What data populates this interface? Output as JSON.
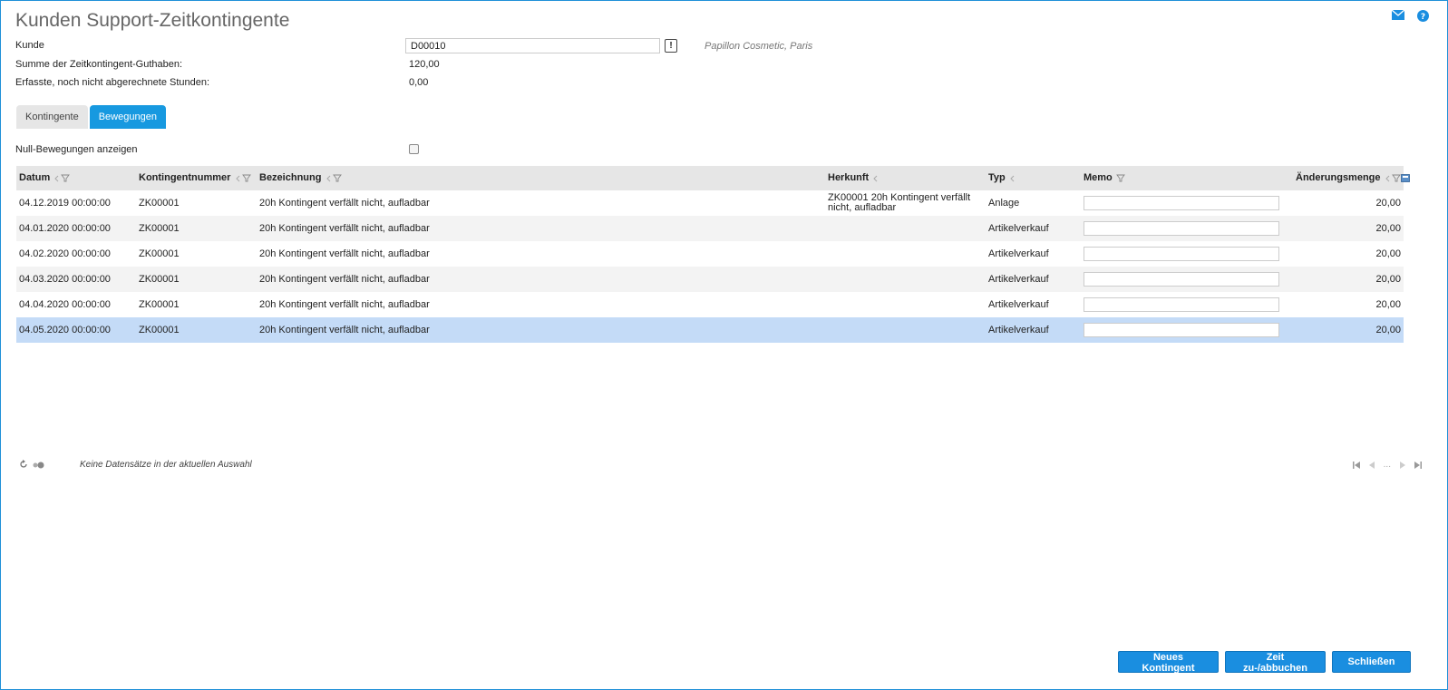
{
  "page": {
    "title": "Kunden Support-Zeitkontingente"
  },
  "customer": {
    "label": "Kunde",
    "value": "D00010",
    "lookup_button": "!",
    "name": "Papillon Cosmetic, Paris"
  },
  "summary": {
    "sum_label": "Summe der Zeitkontingent-Guthaben:",
    "sum_value": "120,00",
    "open_label": "Erfasste, noch nicht abgerechnete Stunden:",
    "open_value": "0,00"
  },
  "tabs": [
    {
      "label": "Kontingente",
      "active": false
    },
    {
      "label": "Bewegungen",
      "active": true
    }
  ],
  "filter": {
    "null_label": "Null-Bewegungen anzeigen",
    "null_checked": false
  },
  "grid": {
    "columns": {
      "datum": "Datum",
      "kontingentnummer": "Kontingentnummer",
      "bezeichnung": "Bezeichnung",
      "herkunft": "Herkunft",
      "typ": "Typ",
      "memo": "Memo",
      "aenderungsmenge": "Änderungsmenge"
    },
    "rows": [
      {
        "datum": "04.12.2019 00:00:00",
        "kontingentnummer": "ZK00001",
        "bezeichnung": "20h Kontingent verfällt nicht, aufladbar",
        "herkunft": "ZK00001 20h Kontingent verfällt nicht, aufladbar",
        "typ": "Anlage",
        "memo": "",
        "aenderungsmenge": "20,00"
      },
      {
        "datum": "04.01.2020 00:00:00",
        "kontingentnummer": "ZK00001",
        "bezeichnung": "20h Kontingent verfällt nicht, aufladbar",
        "herkunft": "",
        "typ": "Artikelverkauf",
        "memo": "",
        "aenderungsmenge": "20,00"
      },
      {
        "datum": "04.02.2020 00:00:00",
        "kontingentnummer": "ZK00001",
        "bezeichnung": "20h Kontingent verfällt nicht, aufladbar",
        "herkunft": "",
        "typ": "Artikelverkauf",
        "memo": "",
        "aenderungsmenge": "20,00"
      },
      {
        "datum": "04.03.2020 00:00:00",
        "kontingentnummer": "ZK00001",
        "bezeichnung": "20h Kontingent verfällt nicht, aufladbar",
        "herkunft": "",
        "typ": "Artikelverkauf",
        "memo": "",
        "aenderungsmenge": "20,00"
      },
      {
        "datum": "04.04.2020 00:00:00",
        "kontingentnummer": "ZK00001",
        "bezeichnung": "20h Kontingent verfällt nicht, aufladbar",
        "herkunft": "",
        "typ": "Artikelverkauf",
        "memo": "",
        "aenderungsmenge": "20,00"
      },
      {
        "datum": "04.05.2020 00:00:00",
        "kontingentnummer": "ZK00001",
        "bezeichnung": "20h Kontingent verfällt nicht, aufladbar",
        "herkunft": "",
        "typ": "Artikelverkauf",
        "memo": "",
        "aenderungsmenge": "20,00",
        "selected": true
      }
    ]
  },
  "footer": {
    "status_text": "Keine Datensätze in der aktuellen Auswahl",
    "pager_ellipsis": "..."
  },
  "buttons": {
    "new_quota": "Neues Kontingent",
    "book_time": "Zeit zu-/abbuchen",
    "close": "Schließen"
  },
  "colors": {
    "accent": "#1799e0",
    "button": "#1a8ee0",
    "selected_row": "#c4dbf7",
    "header_bg": "#e6e6e6"
  }
}
